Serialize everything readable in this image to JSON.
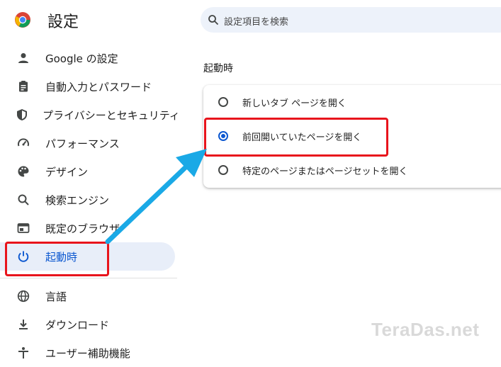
{
  "header": {
    "app_title": "設定",
    "search_placeholder": "設定項目を検索"
  },
  "sidebar": {
    "items": [
      {
        "label": "Google の設定",
        "icon": "person-icon"
      },
      {
        "label": "自動入力とパスワード",
        "icon": "clipboard-icon"
      },
      {
        "label": "プライバシーとセキュリティ",
        "icon": "shield-icon"
      },
      {
        "label": "パフォーマンス",
        "icon": "speedometer-icon"
      },
      {
        "label": "デザイン",
        "icon": "palette-icon"
      },
      {
        "label": "検索エンジン",
        "icon": "search-icon"
      },
      {
        "label": "既定のブラウザ",
        "icon": "browser-window-icon"
      },
      {
        "label": "起動時",
        "icon": "power-icon",
        "active": true
      },
      {
        "label": "言語",
        "icon": "globe-icon"
      },
      {
        "label": "ダウンロード",
        "icon": "download-icon"
      },
      {
        "label": "ユーザー補助機能",
        "icon": "accessibility-icon"
      }
    ]
  },
  "main": {
    "section_title": "起動時",
    "options": [
      {
        "label": "新しいタブ ページを開く",
        "selected": false
      },
      {
        "label": "前回開いていたページを開く",
        "selected": true
      },
      {
        "label": "特定のページまたはページセットを開く",
        "selected": false
      }
    ]
  },
  "watermark": "TeraDas.net",
  "colors": {
    "accent": "#0b57d0",
    "active_bg": "#e8eef9",
    "highlight": "#e8141c",
    "arrow": "#1aa9e6"
  }
}
